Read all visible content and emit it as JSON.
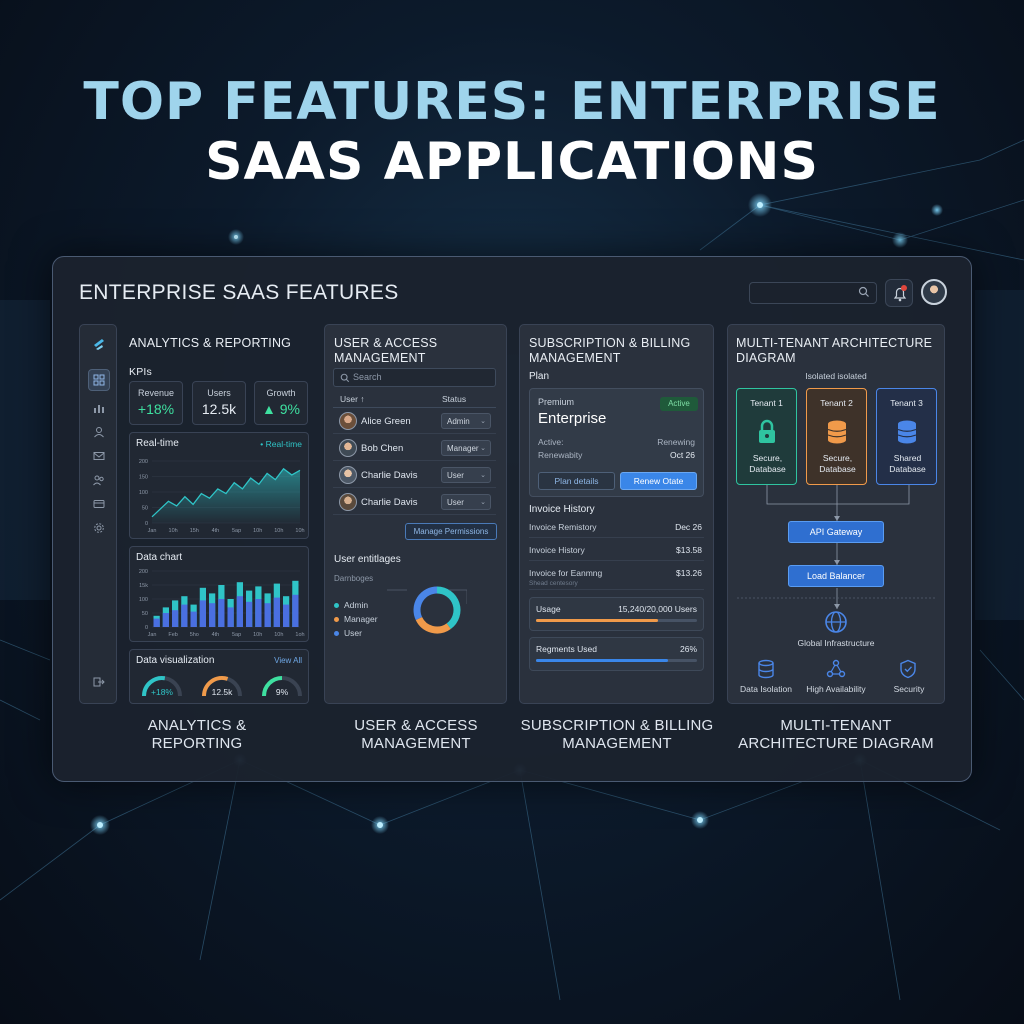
{
  "hero": {
    "line1": "TOP FEATURES: ENTERPRISE",
    "line2": "SAAS APPLICATIONS"
  },
  "board": {
    "title": "ENTERPRISE SAAS FEATURES",
    "search_placeholder": "",
    "sidebar_icons": [
      "logo-icon",
      "dashboard-icon",
      "bar-chart-icon",
      "user-icon",
      "mail-icon",
      "users-icon",
      "billing-icon",
      "settings-icon",
      "logout-icon"
    ]
  },
  "analytics": {
    "title": "ANALYTICS & REPORTING",
    "kpis_label": "KPIs",
    "kpis": [
      {
        "label": "Revenue",
        "value": "+18%",
        "color": "#3ee0a0"
      },
      {
        "label": "Users",
        "value": "12.5k",
        "color": "#e6ecf3"
      },
      {
        "label": "Growth",
        "value": "▲ 9%",
        "color": "#3ee0a0"
      }
    ],
    "realtime": {
      "title": "Real-time",
      "badge": "• Real-time",
      "y_ticks": [
        "200",
        "150",
        "100",
        "50",
        "0"
      ],
      "x_ticks": [
        "Jan",
        "10h",
        "15h",
        "4th",
        "5ap",
        "10h",
        "10h",
        "10h"
      ]
    },
    "data_chart": {
      "title": "Data chart",
      "y_ticks": [
        "200",
        "15k",
        "100",
        "50",
        "0"
      ],
      "x_ticks": [
        "Jan",
        "Feb",
        "5ho",
        "4th",
        "5ap",
        "10h",
        "10h",
        "1oh"
      ]
    },
    "viz": {
      "title": "Data visualization",
      "link": "View All",
      "gauges": [
        {
          "label": "+18%",
          "pct": 0.55,
          "color": "#2fc4c7"
        },
        {
          "label": "12.5k",
          "pct": 0.6,
          "color": "#f09a4a"
        },
        {
          "label": "9%",
          "pct": 0.5,
          "color": "#3ee0a0"
        }
      ]
    },
    "label_line1": "ANALYTICS &",
    "label_line2": "REPORTING"
  },
  "chart_data": [
    {
      "type": "area",
      "title": "Real-time",
      "x": [
        "Jan",
        "10h",
        "15h",
        "4th",
        "5ap",
        "10h",
        "10h",
        "10h"
      ],
      "values": [
        20,
        45,
        70,
        55,
        85,
        60,
        95,
        80,
        110,
        95,
        130,
        110,
        145,
        125,
        160,
        140,
        175,
        155,
        170
      ],
      "ylim": [
        0,
        200
      ]
    },
    {
      "type": "bar",
      "title": "Data chart",
      "x": [
        "Jan",
        "Feb",
        "5ho",
        "4th",
        "5ap",
        "10h",
        "10h",
        "1oh"
      ],
      "series": [
        {
          "values": [
            40,
            70,
            95,
            110,
            80,
            140,
            120,
            150,
            100,
            160,
            130,
            145,
            120,
            155,
            110,
            165
          ]
        },
        {
          "values": [
            30,
            50,
            60,
            80,
            55,
            95,
            85,
            100,
            70,
            110,
            90,
            100,
            85,
            105,
            80,
            115
          ]
        }
      ],
      "ylim": [
        0,
        200
      ]
    },
    {
      "type": "pie",
      "title": "User entitlements",
      "categories": [
        "Admin",
        "Manager",
        "User"
      ],
      "values": [
        40,
        28,
        32
      ]
    }
  ],
  "users": {
    "title_line1": "USER & ACCESS",
    "title_line2": "MANAGEMENT",
    "search_placeholder": "Search",
    "col_user": "User ↑",
    "col_status": "Status",
    "rows": [
      {
        "name": "Alice Green",
        "role": "Admin"
      },
      {
        "name": "Bob Chen",
        "role": "Manager"
      },
      {
        "name": "Charlie Davis",
        "role": "User"
      },
      {
        "name": "Charlie Davis",
        "role": "User"
      }
    ],
    "manage_button": "Manage Permissions",
    "entitlements_title": "User entitlages",
    "dashboard_label": "Darnboges",
    "legend": [
      {
        "label": "Admin",
        "color": "#2fc4c7"
      },
      {
        "label": "Manager",
        "color": "#f09a4a"
      },
      {
        "label": "User",
        "color": "#4a86e8"
      }
    ],
    "label_line1": "USER & ACCESS",
    "label_line2": "MANAGEMENT"
  },
  "billing": {
    "title_line1": "SUBSCRIPTION & BILLING",
    "title_line2": "MANAGEMENT",
    "plan_label": "Plan",
    "plan_tier": "Premium",
    "plan_name": "Enterprise",
    "plan_status": "Active",
    "active_label": "Active:",
    "renewability_label": "Renewabity",
    "renewing_label": "Renewing",
    "renew_date": "Oct 26",
    "plan_details_button": "Plan details",
    "renew_button": "Renew Otate",
    "invoice_title": "Invoice History",
    "invoices": [
      {
        "label": "Invoice Remistory",
        "value": "Dec 26"
      },
      {
        "label": "Invoice History",
        "value": "$13.58"
      },
      {
        "label": "Invoice for Eanmng",
        "value": "$13.26"
      }
    ],
    "invoice_sub": "Shead centesory",
    "usage_label": "Usage",
    "usage_value": "15,240/20,000 Users",
    "usage_pct": 0.76,
    "regments_label": "Regments Used",
    "regments_value": "26%",
    "regments_pct": 0.82,
    "label_line1": "SUBSCRIPTION & BILLING",
    "label_line2": "MANAGEMENT"
  },
  "arch": {
    "title_line1": "MULTI-TENANT ARCHITECTURE",
    "title_line2": "DIAGRAM",
    "isolated_label": "Isolated isolated",
    "tenants": [
      {
        "name": "Tenant 1",
        "desc1": "Secure,",
        "desc2": "Database",
        "color": "#2fc4a0",
        "bg": "#1f3b3b",
        "icon": "lock-icon"
      },
      {
        "name": "Tenant 2",
        "desc1": "Secure,",
        "desc2": "Database",
        "color": "#f09a4a",
        "bg": "#3e3229",
        "icon": "database-icon"
      },
      {
        "name": "Tenant 3",
        "desc1": "Shared",
        "desc2": "Database",
        "color": "#4a86e8",
        "bg": "#232f48",
        "icon": "database-icon"
      }
    ],
    "api_gateway": "API Gateway",
    "load_balancer": "Load Balancer",
    "global_infra": "Global Infrastructure",
    "footer": [
      "Data Isolation",
      "High Availability",
      "Security"
    ],
    "label_line1": "MULTI-TENANT",
    "label_line2": "ARCHITECTURE DIAGRAM"
  }
}
